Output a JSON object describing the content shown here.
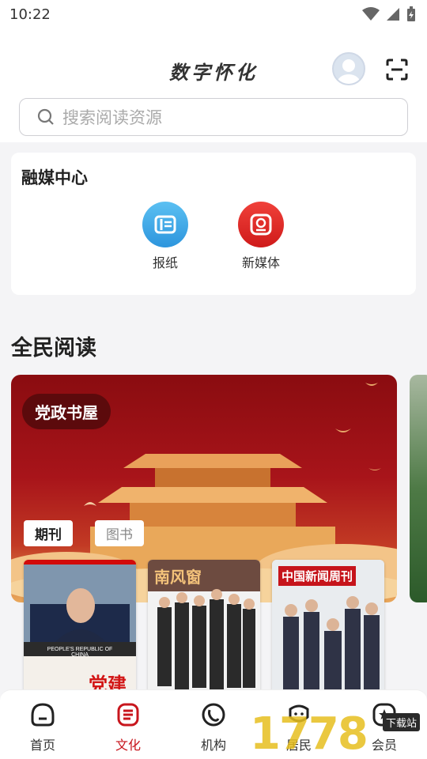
{
  "status": {
    "time": "10:22"
  },
  "header": {
    "title": "数字怀化",
    "search_placeholder": "搜索阅读资源"
  },
  "media_center": {
    "title": "融媒中心",
    "items": [
      {
        "label": "报纸",
        "icon": "newspaper-icon",
        "color": "#3aa6e6"
      },
      {
        "label": "新媒体",
        "icon": "new-media-icon",
        "color": "#e02a2a"
      }
    ]
  },
  "reading": {
    "title": "全民阅读",
    "banner_label": "党政书屋",
    "tabs": [
      {
        "label": "期刊",
        "active": true
      },
      {
        "label": "图书",
        "active": false
      }
    ],
    "magazines": [
      {
        "cover_text": "PEOPLE'S REPUBLIC OF CHINA",
        "masthead": "党建"
      },
      {
        "cover_text": "南风窗"
      },
      {
        "cover_text": "中国新闻周刊"
      }
    ]
  },
  "bottom_nav": [
    {
      "label": "首页",
      "icon": "home-icon",
      "active": false
    },
    {
      "label": "文化",
      "icon": "culture-icon",
      "active": true
    },
    {
      "label": "机构",
      "icon": "institution-icon",
      "active": false
    },
    {
      "label": "居民",
      "icon": "resident-icon",
      "active": false
    },
    {
      "label": "会员",
      "icon": "member-icon",
      "active": false
    }
  ],
  "watermark": {
    "text": "1778",
    "tag": "下载站"
  },
  "colors": {
    "accent": "#c8161d",
    "banner": "#a8141a"
  }
}
